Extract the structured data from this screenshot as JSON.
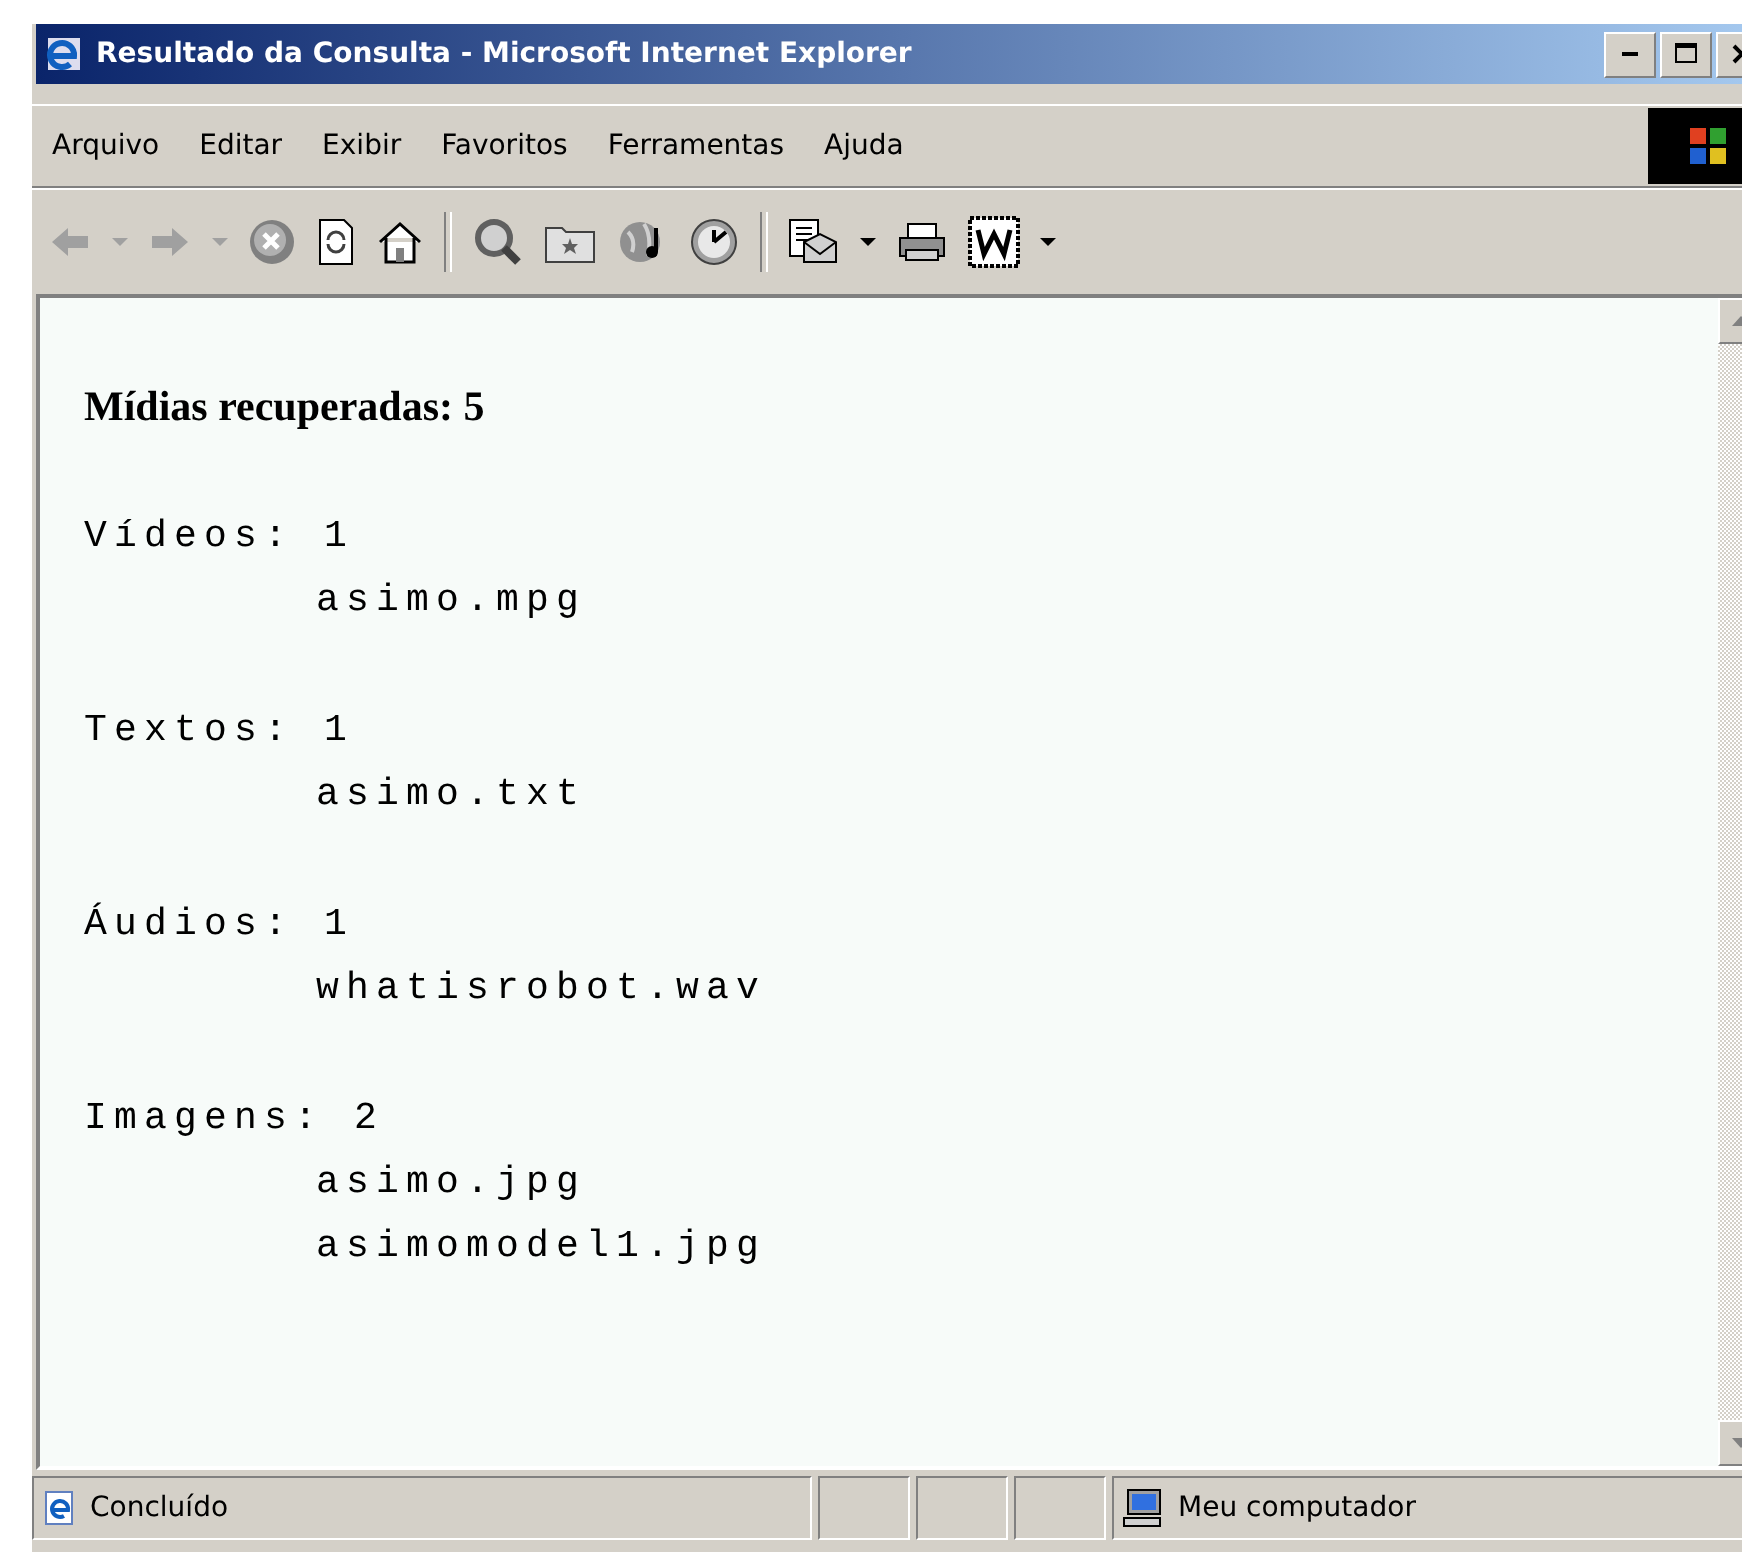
{
  "window": {
    "title": "Resultado da Consulta - Microsoft Internet Explorer"
  },
  "menu": [
    "Arquivo",
    "Editar",
    "Exibir",
    "Favoritos",
    "Ferramentas",
    "Ajuda"
  ],
  "content": {
    "heading": "Mídias recuperadas: 5",
    "groups": [
      {
        "label": "Vídeos: 1",
        "files": [
          "asimo.mpg"
        ]
      },
      {
        "label": "Textos: 1",
        "files": [
          "asimo.txt"
        ]
      },
      {
        "label": "Áudios: 1",
        "files": [
          "whatisrobot.wav"
        ]
      },
      {
        "label": "Imagens: 2",
        "files": [
          "asimo.jpg",
          "asimomodel1.jpg"
        ]
      }
    ]
  },
  "status_bar": {
    "status": "Concluído",
    "zone": "Meu computador"
  }
}
